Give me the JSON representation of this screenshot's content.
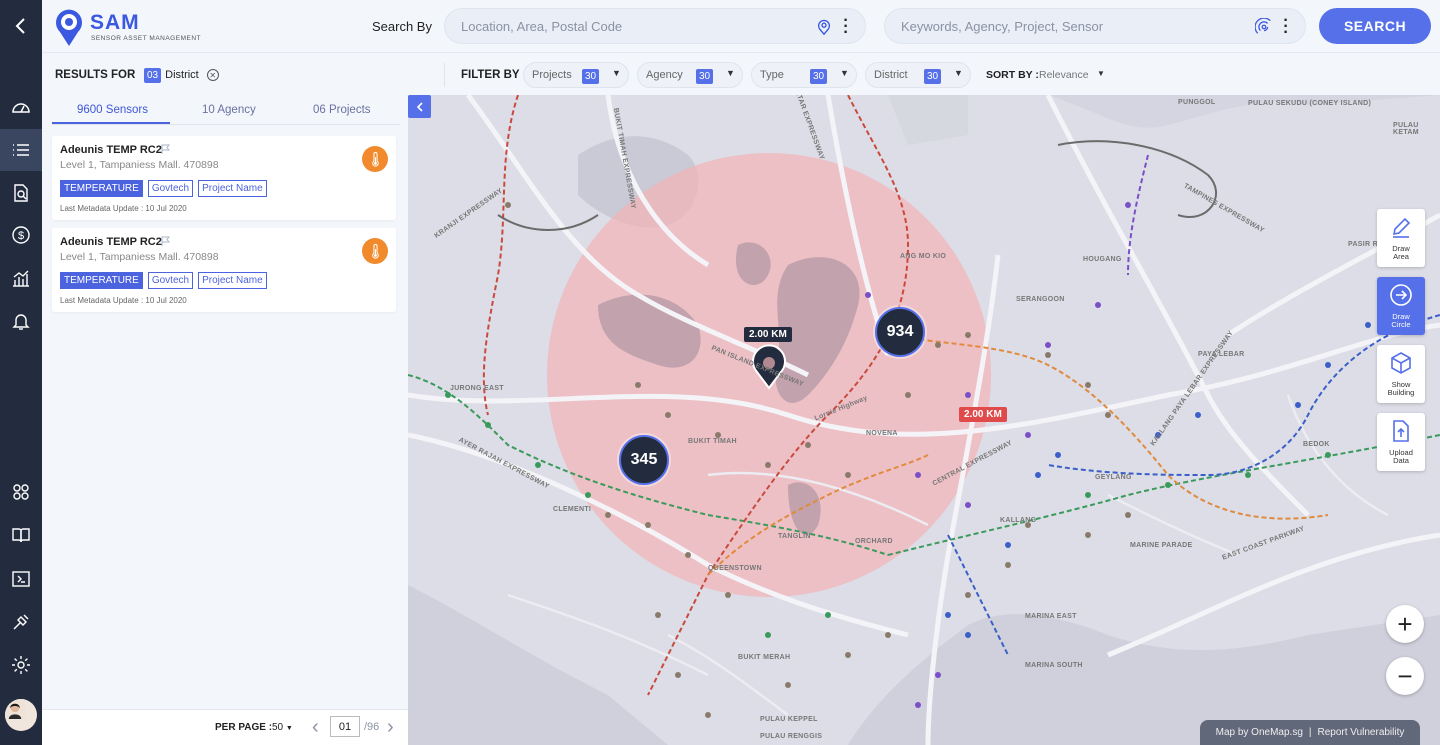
{
  "app": {
    "name": "SAM",
    "subtitle": "SENSOR ASSET MANAGEMENT"
  },
  "header": {
    "search_by_label": "Search By",
    "location_placeholder": "Location, Area, Postal Code",
    "keywords_placeholder": "Keywords, Agency, Project, Sensor",
    "search_button": "SEARCH"
  },
  "results_for": {
    "label": "RESULTS FOR",
    "count": "03",
    "value": "District"
  },
  "filters": {
    "label": "FILTER BY",
    "items": [
      {
        "label": "Projects",
        "count": "30"
      },
      {
        "label": "Agency",
        "count": "30"
      },
      {
        "label": "Type",
        "count": "30"
      },
      {
        "label": "District",
        "count": "30"
      }
    ],
    "sort_label": "SORT BY :",
    "sort_value": "Relevance"
  },
  "tabs": [
    {
      "label": "9600 Sensors",
      "active": true
    },
    {
      "label": "10 Agency",
      "active": false
    },
    {
      "label": "06 Projects",
      "active": false
    }
  ],
  "sensors": [
    {
      "name": "Adeunis TEMP RC2",
      "address": "Level 1, Tampaniess Mall. 470898",
      "tags": [
        "TEMPERATURE",
        "Govtech",
        "Project Name"
      ],
      "meta": "Last Metadata Update : 10 Jul 2020",
      "icon": "thermometer-icon"
    },
    {
      "name": "Adeunis TEMP RC2",
      "address": "Level 1, Tampaniess Mall. 470898",
      "tags": [
        "TEMPERATURE",
        "Govtech",
        "Project Name"
      ],
      "meta": "Last Metadata Update : 10 Jul 2020",
      "icon": "thermometer-icon"
    }
  ],
  "pagination": {
    "per_page_label": "PER PAGE :",
    "per_page_value": "50",
    "current_page": "01",
    "total_pages": "/96"
  },
  "map": {
    "radius_marker_label": "2.00 KM",
    "radius_edge_label": "2.00 KM",
    "clusters": [
      "934",
      "345"
    ],
    "tools": [
      {
        "label": "Draw Area",
        "icon": "pencil-icon"
      },
      {
        "label": "Draw Circle",
        "icon": "circle-arrow-icon"
      },
      {
        "label": "Show Building",
        "icon": "cube-icon"
      },
      {
        "label": "Upload Data",
        "icon": "upload-file-icon"
      }
    ],
    "attribution": "Map by OneMap.sg",
    "report_link": "Report Vulnerability",
    "place_labels": [
      "PUNGGOL",
      "PULAU KETAM",
      "ANG MO KIO",
      "HOUGANG",
      "SERANGOON",
      "PASIR RIS",
      "PAYA LEBAR",
      "JURONG EAST",
      "BUKIT TIMAH",
      "NOVENA",
      "BEDOK",
      "GEYLANG",
      "CLEMENTI",
      "KALLANG",
      "MARINE PARADE",
      "TANGLIN",
      "ORCHARD",
      "QUEENSTOWN",
      "MARINA EAST",
      "MARINA SOUTH",
      "BUKIT MERAH",
      "PULAU KEPPEL",
      "PULAU RENGGIS",
      "PAN ISLAND EXPRESSWAY",
      "AYER RAJAH EXPRESSWAY",
      "EAST COAST PARKWAY",
      "CENTRAL EXPRESSWAY",
      "TAMPINES EXPRESSWAY",
      "KALLANG PAYA LEBAR EXPRESSWAY",
      "KRANJI EXPRESSWAY",
      "BUKIT TIMAH EXPRESSWAY",
      "SELETAR EXPRESSWAY",
      "Lornie Highway",
      "PULAU SEKUDU (CONEY ISLAND)"
    ]
  },
  "colors": {
    "primary": "#5570e8",
    "sidebar": "#232c3e",
    "thermo": "#f18a2c",
    "circle": "#f3b3b6",
    "radius_label": "#e04a4a"
  }
}
